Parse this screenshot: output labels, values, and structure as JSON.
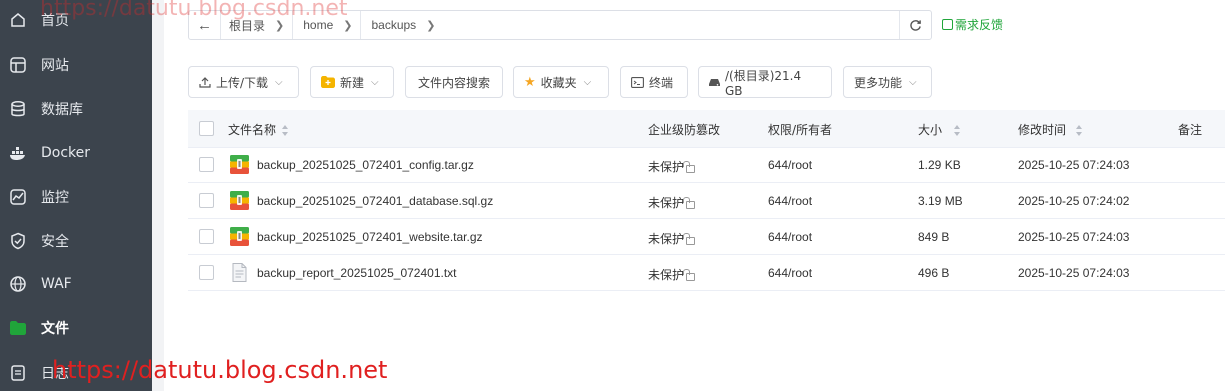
{
  "sidebar": {
    "items": [
      {
        "label": "首页",
        "icon": "home-icon"
      },
      {
        "label": "网站",
        "icon": "website-icon"
      },
      {
        "label": "数据库",
        "icon": "database-icon"
      },
      {
        "label": "Docker",
        "icon": "docker-icon"
      },
      {
        "label": "监控",
        "icon": "monitor-icon"
      },
      {
        "label": "安全",
        "icon": "shield-icon"
      },
      {
        "label": "WAF",
        "icon": "waf-icon"
      },
      {
        "label": "文件",
        "icon": "folder-icon",
        "active": true
      },
      {
        "label": "日志",
        "icon": "log-icon"
      }
    ]
  },
  "path": {
    "crumbs": [
      "根目录",
      "home",
      "backups"
    ]
  },
  "feedback_label": "需求反馈",
  "toolbar": {
    "upload_label": "上传/下载",
    "new_label": "新建",
    "search_label": "文件内容搜索",
    "favorites_label": "收藏夹",
    "terminal_label": "终端",
    "disk_label": "/(根目录)21.4 GB",
    "more_label": "更多功能"
  },
  "table": {
    "headers": {
      "name": "文件名称",
      "protection": "企业级防篡改",
      "perm": "权限/所有者",
      "size": "大小",
      "mtime": "修改时间",
      "note": "备注"
    },
    "rows": [
      {
        "name": "backup_20251025_072401_config.tar.gz",
        "protection": "未保护",
        "perm": "644/root",
        "size": "1.29 KB",
        "mtime": "2025-10-25 07:24:03",
        "icon": "archive-icon"
      },
      {
        "name": "backup_20251025_072401_database.sql.gz",
        "protection": "未保护",
        "perm": "644/root",
        "size": "3.19 MB",
        "mtime": "2025-10-25 07:24:02",
        "icon": "archive-icon"
      },
      {
        "name": "backup_20251025_072401_website.tar.gz",
        "protection": "未保护",
        "perm": "644/root",
        "size": "849 B",
        "mtime": "2025-10-25 07:24:03",
        "icon": "archive-icon"
      },
      {
        "name": "backup_report_20251025_072401.txt",
        "protection": "未保护",
        "perm": "644/root",
        "size": "496 B",
        "mtime": "2025-10-25 07:24:03",
        "icon": "text-file-icon"
      }
    ]
  },
  "watermark": {
    "top": "https://datutu.blog.csdn.net",
    "bottom": "https://datutu.blog.csdn.net"
  },
  "colors": {
    "sidebar_bg": "#3c444d",
    "accent_green": "#20a53a"
  }
}
